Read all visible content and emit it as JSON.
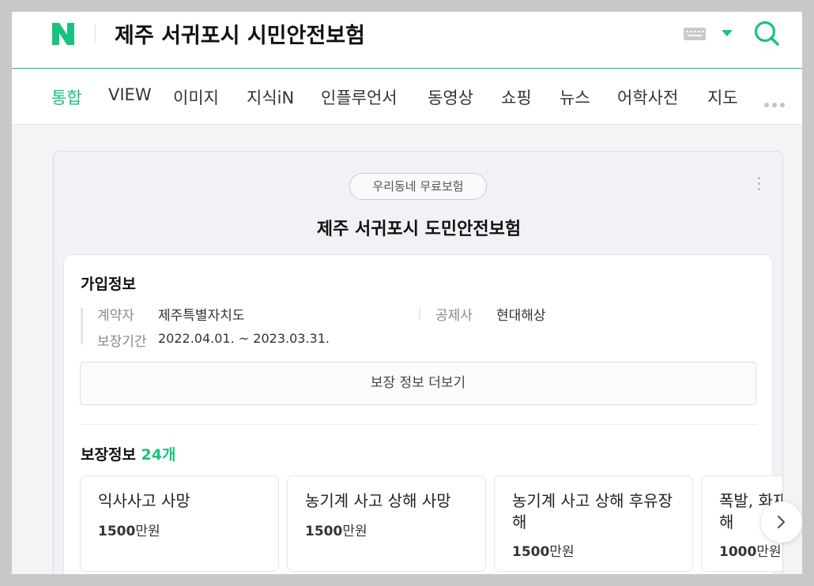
{
  "header": {
    "logo_letter": "N",
    "query": "제주 서귀포시 시민안전보험"
  },
  "tabs": [
    {
      "label": "통합",
      "active": true
    },
    {
      "label": "VIEW"
    },
    {
      "label": "이미지"
    },
    {
      "label": "지식iN"
    },
    {
      "label": "인플루언서"
    },
    {
      "label": "동영상"
    },
    {
      "label": "쇼핑"
    },
    {
      "label": "뉴스"
    },
    {
      "label": "어학사전"
    },
    {
      "label": "지도"
    }
  ],
  "card": {
    "pill": "우리동네 무료보험",
    "title": "제주 서귀포시 도민안전보험",
    "join_info": {
      "title": "가입정보",
      "contractor_label": "계약자",
      "contractor_value": "제주특별자치도",
      "insurer_label": "공제사",
      "insurer_value": "현대해상",
      "period_label": "보장기간",
      "period_value": "2022.04.01. ~ 2023.03.31."
    },
    "more_button": "보장 정보 더보기",
    "coverage": {
      "title": "보장정보",
      "count": "24개",
      "items": [
        {
          "name": "익사사고 사망",
          "amount_num": "1500",
          "amount_unit": "만원"
        },
        {
          "name": "농기계 사고 상해 사망",
          "amount_num": "1500",
          "amount_unit": "만원"
        },
        {
          "name": "농기계 사고 상해 후유장해",
          "amount_num": "1500",
          "amount_unit": "만원"
        },
        {
          "name": "폭발, 화재, 붕괴 상태 상해",
          "amount_num": "1000",
          "amount_unit": "만원"
        }
      ]
    }
  },
  "colors": {
    "accent": "#19c37d"
  }
}
